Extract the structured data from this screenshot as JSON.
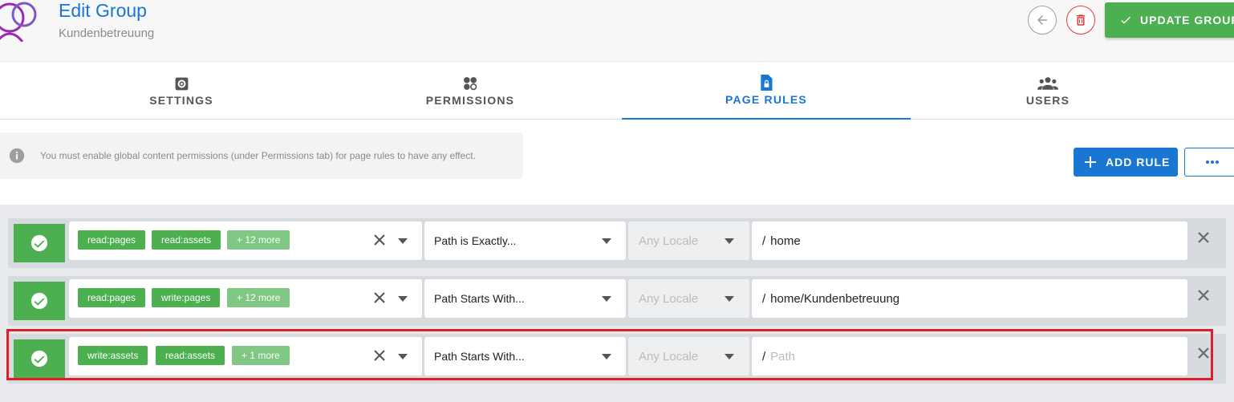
{
  "header": {
    "title": "Edit Group",
    "subtitle": "Kundenbetreuung",
    "update_label": "UPDATE GROUP",
    "colors": {
      "accent": "#1976d2",
      "success": "#4caf50",
      "danger": "#e53935"
    }
  },
  "tabs": [
    {
      "label": "SETTINGS",
      "icon": "gear-icon"
    },
    {
      "label": "PERMISSIONS",
      "icon": "permissions-icon"
    },
    {
      "label": "PAGE RULES",
      "icon": "lock-file-icon",
      "active": true
    },
    {
      "label": "USERS",
      "icon": "users-icon"
    }
  ],
  "alert": {
    "text": "You must enable global content permissions (under Permissions tab) for page rules to have any effect."
  },
  "actions": {
    "add_rule_label": "ADD RULE"
  },
  "rules": [
    {
      "chips": [
        "read:pages",
        "read:assets"
      ],
      "more": "+ 12 more",
      "match": "Path is Exactly...",
      "locale": "Any Locale",
      "path_prefix": "/",
      "path": "home"
    },
    {
      "chips": [
        "read:pages",
        "write:pages"
      ],
      "more": "+ 12 more",
      "match": "Path Starts With...",
      "locale": "Any Locale",
      "path_prefix": "/",
      "path": "home/Kundenbetreuung"
    },
    {
      "chips": [
        "write:assets",
        "read:assets"
      ],
      "more": "+ 1 more",
      "match": "Path Starts With...",
      "locale": "Any Locale",
      "path_prefix": "/",
      "path_placeholder": "Path"
    }
  ]
}
